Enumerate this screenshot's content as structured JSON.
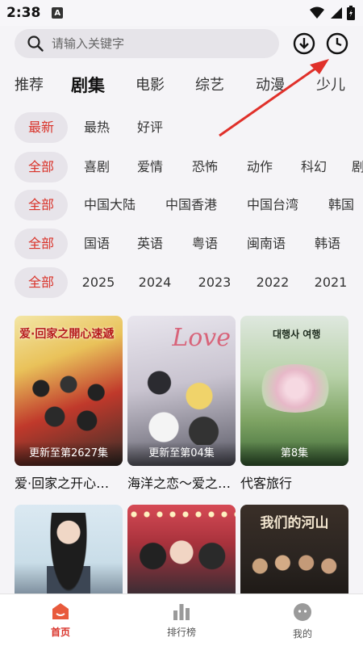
{
  "status_bar": {
    "time": "2:38",
    "notif_letter": "A"
  },
  "search": {
    "placeholder": "请输入关键字"
  },
  "header_icons": {
    "download": "download-icon",
    "history": "history-icon"
  },
  "tabs": [
    {
      "label": "推荐",
      "active": false
    },
    {
      "label": "剧集",
      "active": true
    },
    {
      "label": "电影",
      "active": false
    },
    {
      "label": "综艺",
      "active": false
    },
    {
      "label": "动漫",
      "active": false
    },
    {
      "label": "少儿",
      "active": false
    }
  ],
  "filters": {
    "sort": [
      "最新",
      "最热",
      "好评"
    ],
    "genre": [
      "全部",
      "喜剧",
      "爱情",
      "恐怖",
      "动作",
      "科幻",
      "剧"
    ],
    "region": [
      "全部",
      "中国大陆",
      "中国香港",
      "中国台湾",
      "韩国"
    ],
    "language": [
      "全部",
      "国语",
      "英语",
      "粤语",
      "闽南语",
      "韩语"
    ],
    "year": [
      "全部",
      "2025",
      "2024",
      "2023",
      "2022",
      "2021"
    ]
  },
  "cards": [
    {
      "title": "爱·回家之开心…",
      "episode": "更新至第2627集",
      "poster_text": "爱·回家之開心速遞"
    },
    {
      "title": "海洋之恋～爱之…",
      "episode": "更新至第04集",
      "poster_text": "Love"
    },
    {
      "title": "代客旅行",
      "episode": "第8集",
      "poster_text": "대행사 여행"
    },
    {
      "title": "",
      "episode": "",
      "poster_text": ""
    },
    {
      "title": "",
      "episode": "",
      "poster_text": ""
    },
    {
      "title": "",
      "episode": "",
      "poster_text": "我们的河山"
    }
  ],
  "bottom_nav": [
    {
      "label": "首页",
      "icon": "home-icon",
      "active": true
    },
    {
      "label": "排行榜",
      "icon": "bar-chart-icon",
      "active": false
    },
    {
      "label": "我的",
      "icon": "profile-icon",
      "active": false
    }
  ],
  "colors": {
    "accent": "#d9332a",
    "chip_bg": "#e7e4ea",
    "page_bg": "#f5f4f7"
  }
}
